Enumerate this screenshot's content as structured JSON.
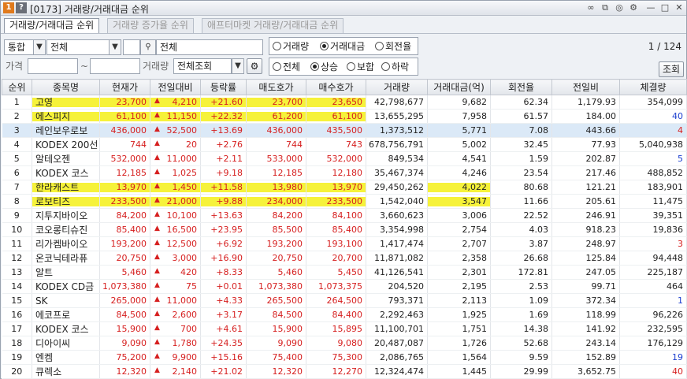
{
  "window": {
    "title": "[0173] 거래량/거래대금 순위",
    "icon_labels": [
      "1",
      "?"
    ]
  },
  "tabs": [
    {
      "label": "거래량/거래대금 순위",
      "active": true
    },
    {
      "label": "거래량 증가율 순위",
      "active": false
    },
    {
      "label": "애프터마켓 거래량/거래대금 순위",
      "active": false
    }
  ],
  "filters": {
    "market": "통합",
    "category": "전체",
    "stock_name": "전체",
    "price_label": "가격",
    "price_from": "",
    "price_to": "",
    "tilde": "~",
    "volume_label": "거래량",
    "volume_value": "전체조회"
  },
  "sort_options": [
    {
      "label": "거래량",
      "checked": false
    },
    {
      "label": "거래대금",
      "checked": true
    },
    {
      "label": "회전율",
      "checked": false
    }
  ],
  "direction_options": [
    {
      "label": "전체",
      "checked": false
    },
    {
      "label": "상승",
      "checked": true
    },
    {
      "label": "보합",
      "checked": false
    },
    {
      "label": "하락",
      "checked": false
    }
  ],
  "page_info": "1 / 124",
  "query_button": "조회",
  "colors": {
    "up": "#d61f1f",
    "down": "#1c3fd0",
    "highlight": "#f6f23a",
    "selected_row": "#dbe9f7"
  },
  "columns": [
    "순위",
    "종목명",
    "현재가",
    "전일대비",
    "등락률",
    "매도호가",
    "매수호가",
    "거래량",
    "거래대금(억)",
    "회전율",
    "전일비",
    "체결량"
  ],
  "rows": [
    {
      "rank": "1",
      "name": "고영",
      "price": "23,700",
      "change": "4,210",
      "rate": "+21.60",
      "ask": "23,700",
      "bid": "23,650",
      "volume": "42,798,677",
      "amount": "9,682",
      "turnover": "62.34",
      "vs_prev": "1,179.93",
      "exec": "354,099",
      "exec_color": "black"
    },
    {
      "rank": "2",
      "name": "에스피지",
      "price": "61,100",
      "change": "11,150",
      "rate": "+22.32",
      "ask": "61,200",
      "bid": "61,100",
      "volume": "13,655,295",
      "amount": "7,958",
      "turnover": "61.57",
      "vs_prev": "184.00",
      "exec": "40",
      "exec_color": "blue"
    },
    {
      "rank": "3",
      "name": "레인보우로보",
      "price": "436,000",
      "change": "52,500",
      "rate": "+13.69",
      "ask": "436,000",
      "bid": "435,500",
      "volume": "1,373,512",
      "amount": "5,771",
      "turnover": "7.08",
      "vs_prev": "443.66",
      "exec": "4",
      "exec_color": "red"
    },
    {
      "rank": "4",
      "name": "KODEX 200선",
      "price": "744",
      "change": "20",
      "rate": "+2.76",
      "ask": "744",
      "bid": "743",
      "volume": "678,756,791",
      "amount": "5,002",
      "turnover": "32.45",
      "vs_prev": "77.93",
      "exec": "5,040,938",
      "exec_color": "black"
    },
    {
      "rank": "5",
      "name": "알테오젠",
      "price": "532,000",
      "change": "11,000",
      "rate": "+2.11",
      "ask": "533,000",
      "bid": "532,000",
      "volume": "849,534",
      "amount": "4,541",
      "turnover": "1.59",
      "vs_prev": "202.87",
      "exec": "5",
      "exec_color": "blue"
    },
    {
      "rank": "6",
      "name": "KODEX 코스",
      "price": "12,185",
      "change": "1,025",
      "rate": "+9.18",
      "ask": "12,185",
      "bid": "12,180",
      "volume": "35,467,374",
      "amount": "4,246",
      "turnover": "23.54",
      "vs_prev": "217.46",
      "exec": "488,852",
      "exec_color": "black"
    },
    {
      "rank": "7",
      "name": "한라캐스트",
      "price": "13,970",
      "change": "1,450",
      "rate": "+11.58",
      "ask": "13,980",
      "bid": "13,970",
      "volume": "29,450,262",
      "amount": "4,022",
      "turnover": "80.68",
      "vs_prev": "121.21",
      "exec": "183,901",
      "exec_color": "black"
    },
    {
      "rank": "8",
      "name": "로보티즈",
      "price": "233,500",
      "change": "21,000",
      "rate": "+9.88",
      "ask": "234,000",
      "bid": "233,500",
      "volume": "1,542,040",
      "amount": "3,547",
      "turnover": "11.66",
      "vs_prev": "205.61",
      "exec": "11,475",
      "exec_color": "black"
    },
    {
      "rank": "9",
      "name": "지투지바이오",
      "price": "84,200",
      "change": "10,100",
      "rate": "+13.63",
      "ask": "84,200",
      "bid": "84,100",
      "volume": "3,660,623",
      "amount": "3,006",
      "turnover": "22.52",
      "vs_prev": "246.91",
      "exec": "39,351",
      "exec_color": "black"
    },
    {
      "rank": "10",
      "name": "코오롱티슈진",
      "price": "85,400",
      "change": "16,500",
      "rate": "+23.95",
      "ask": "85,500",
      "bid": "85,400",
      "volume": "3,354,998",
      "amount": "2,754",
      "turnover": "4.03",
      "vs_prev": "918.23",
      "exec": "19,836",
      "exec_color": "black"
    },
    {
      "rank": "11",
      "name": "리가켐바이오",
      "price": "193,200",
      "change": "12,500",
      "rate": "+6.92",
      "ask": "193,200",
      "bid": "193,100",
      "volume": "1,417,474",
      "amount": "2,707",
      "turnover": "3.87",
      "vs_prev": "248.97",
      "exec": "3",
      "exec_color": "red"
    },
    {
      "rank": "12",
      "name": "온코닉테라퓨",
      "price": "20,750",
      "change": "3,000",
      "rate": "+16.90",
      "ask": "20,750",
      "bid": "20,700",
      "volume": "11,871,082",
      "amount": "2,358",
      "turnover": "26.68",
      "vs_prev": "125.84",
      "exec": "94,448",
      "exec_color": "black"
    },
    {
      "rank": "13",
      "name": "알트",
      "price": "5,460",
      "change": "420",
      "rate": "+8.33",
      "ask": "5,460",
      "bid": "5,450",
      "volume": "41,126,541",
      "amount": "2,301",
      "turnover": "172.81",
      "vs_prev": "247.05",
      "exec": "225,187",
      "exec_color": "black"
    },
    {
      "rank": "14",
      "name": "KODEX CD금",
      "price": "1,073,380",
      "change": "75",
      "rate": "+0.01",
      "ask": "1,073,380",
      "bid": "1,073,375",
      "volume": "204,520",
      "amount": "2,195",
      "turnover": "2.53",
      "vs_prev": "99.71",
      "exec": "464",
      "exec_color": "black"
    },
    {
      "rank": "15",
      "name": "SK",
      "price": "265,000",
      "change": "11,000",
      "rate": "+4.33",
      "ask": "265,500",
      "bid": "264,500",
      "volume": "793,371",
      "amount": "2,113",
      "turnover": "1.09",
      "vs_prev": "372.34",
      "exec": "1",
      "exec_color": "blue"
    },
    {
      "rank": "16",
      "name": "에코프로",
      "price": "84,500",
      "change": "2,600",
      "rate": "+3.17",
      "ask": "84,500",
      "bid": "84,400",
      "volume": "2,292,463",
      "amount": "1,925",
      "turnover": "1.69",
      "vs_prev": "118.99",
      "exec": "96,226",
      "exec_color": "black"
    },
    {
      "rank": "17",
      "name": "KODEX 코스",
      "price": "15,900",
      "change": "700",
      "rate": "+4.61",
      "ask": "15,900",
      "bid": "15,895",
      "volume": "11,100,701",
      "amount": "1,751",
      "turnover": "14.38",
      "vs_prev": "141.92",
      "exec": "232,595",
      "exec_color": "black"
    },
    {
      "rank": "18",
      "name": "디아이씨",
      "price": "9,090",
      "change": "1,780",
      "rate": "+24.35",
      "ask": "9,090",
      "bid": "9,080",
      "volume": "20,487,087",
      "amount": "1,726",
      "turnover": "52.68",
      "vs_prev": "243.14",
      "exec": "176,129",
      "exec_color": "black"
    },
    {
      "rank": "19",
      "name": "엔켐",
      "price": "75,200",
      "change": "9,900",
      "rate": "+15.16",
      "ask": "75,400",
      "bid": "75,300",
      "volume": "2,086,765",
      "amount": "1,564",
      "turnover": "9.59",
      "vs_prev": "152.89",
      "exec": "19",
      "exec_color": "blue"
    },
    {
      "rank": "20",
      "name": "큐렉소",
      "price": "12,320",
      "change": "2,140",
      "rate": "+21.02",
      "ask": "12,320",
      "bid": "12,270",
      "volume": "12,324,474",
      "amount": "1,445",
      "turnover": "29.99",
      "vs_prev": "3,652.75",
      "exec": "40",
      "exec_color": "red"
    }
  ],
  "highlighted_rows": [
    "1",
    "2",
    "3",
    "7",
    "8"
  ],
  "selected_row": "3"
}
